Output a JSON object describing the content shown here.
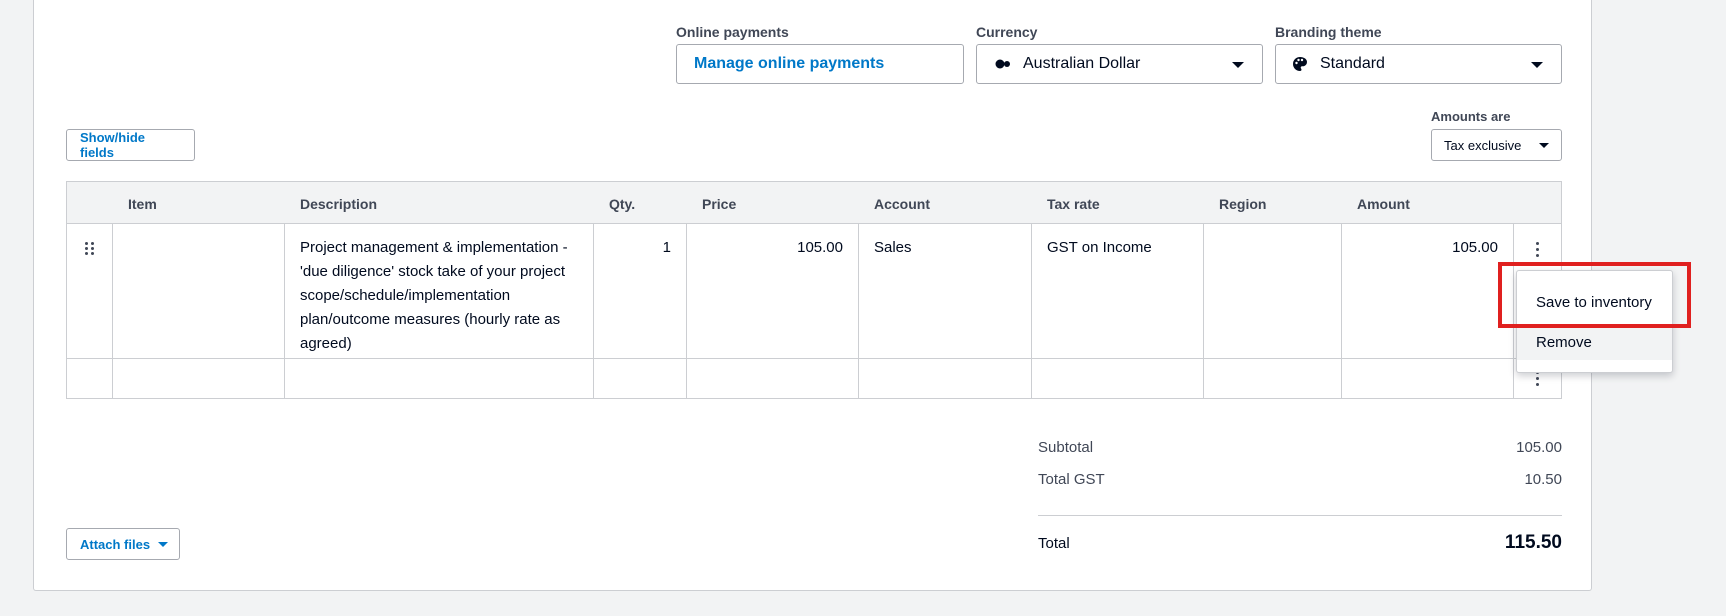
{
  "top_fields": {
    "online_payments": {
      "label": "Online payments",
      "value": "Manage online payments"
    },
    "currency": {
      "label": "Currency",
      "value": "Australian Dollar",
      "icon": "currency-dots-icon"
    },
    "branding": {
      "label": "Branding theme",
      "value": "Standard",
      "icon": "palette-icon"
    }
  },
  "show_hide_fields": "Show/hide fields",
  "amounts_are": {
    "label": "Amounts are",
    "value": "Tax exclusive"
  },
  "table": {
    "headers": [
      "",
      "Item",
      "Description",
      "Qty.",
      "Price",
      "Account",
      "Tax rate",
      "Region",
      "Amount",
      ""
    ],
    "rows": [
      {
        "item": "",
        "description": "Project management & implementation - 'due diligence' stock take of your project scope/schedule/implementation plan/outcome measures (hourly rate as agreed)",
        "qty": "1",
        "price": "105.00",
        "account": "Sales",
        "tax_rate": "GST on Income",
        "region": "",
        "amount": "105.00"
      },
      {
        "item": "",
        "description": "",
        "qty": "",
        "price": "",
        "account": "",
        "tax_rate": "",
        "region": "",
        "amount": ""
      }
    ]
  },
  "totals": {
    "subtotal_label": "Subtotal",
    "subtotal": "105.00",
    "gst_label": "Total GST",
    "gst": "10.50",
    "total_label": "Total",
    "total": "115.50"
  },
  "attach_files": "Attach files",
  "row_menu": {
    "items": [
      "Save to inventory",
      "Remove"
    ]
  },
  "colors": {
    "accent": "#0078c8",
    "highlight": "#e0201f"
  }
}
